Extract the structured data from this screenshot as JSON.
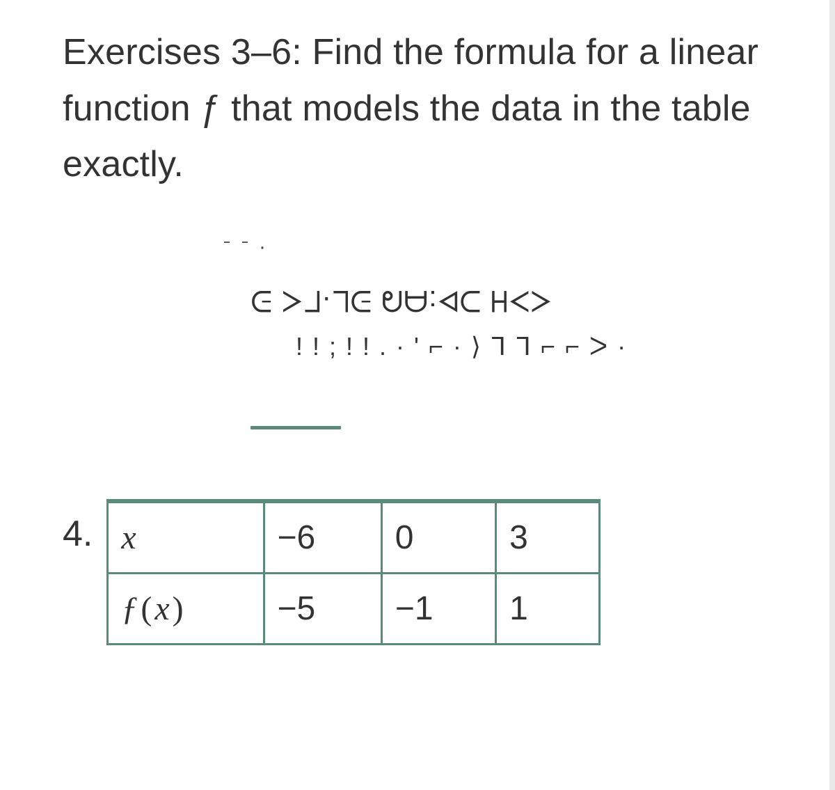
{
  "instructions": "Exercises 3–6: Find the formula for a linear function ƒ that models the data in the table exactly.",
  "garble": {
    "line1": "ᐨ ᐨ ·",
    "line2": "ᕮ ᐳᒣ·ᒧᕮ ᕠᗩ:ᐊᑕ ᕼᐸᐳ",
    "line3": "! !    ; ! ! . ·     '  ⌐ · ⟩ ᒣ ᒣ ⌐   ⌐ ᐳ ·"
  },
  "problem_number": "4.",
  "table": {
    "row1_header": "x",
    "row2_header_fn": "ƒ",
    "row2_header_paren_open": "(",
    "row2_header_var": "x",
    "row2_header_paren_close": ")",
    "row1": [
      "−6",
      "0",
      "3"
    ],
    "row2": [
      "−5",
      "−1",
      "1"
    ]
  },
  "chart_data": {
    "type": "table",
    "title": "Exercise 4 data table",
    "columns": [
      "x",
      "f(x)"
    ],
    "rows": [
      {
        "x": -6,
        "f(x)": -5
      },
      {
        "x": 0,
        "f(x)": -1
      },
      {
        "x": 3,
        "f(x)": 1
      }
    ]
  }
}
